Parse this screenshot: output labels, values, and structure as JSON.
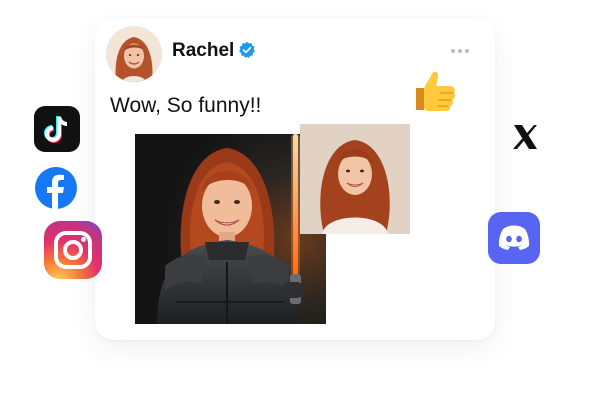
{
  "post": {
    "author": "Rachel",
    "verified": true,
    "caption": "Wow, So funny!!",
    "more_icon": "more-horizontal-icon"
  },
  "reaction_icon": "thumbs-up-icon",
  "social_icons": [
    "tiktok-icon",
    "facebook-icon",
    "instagram-icon",
    "x-icon",
    "discord-icon"
  ],
  "colors": {
    "verified_blue": "#1d9bf0",
    "facebook_blue": "#1877f2",
    "discord_blurple": "#5865f2",
    "saber_orange": "#ff7a18"
  }
}
